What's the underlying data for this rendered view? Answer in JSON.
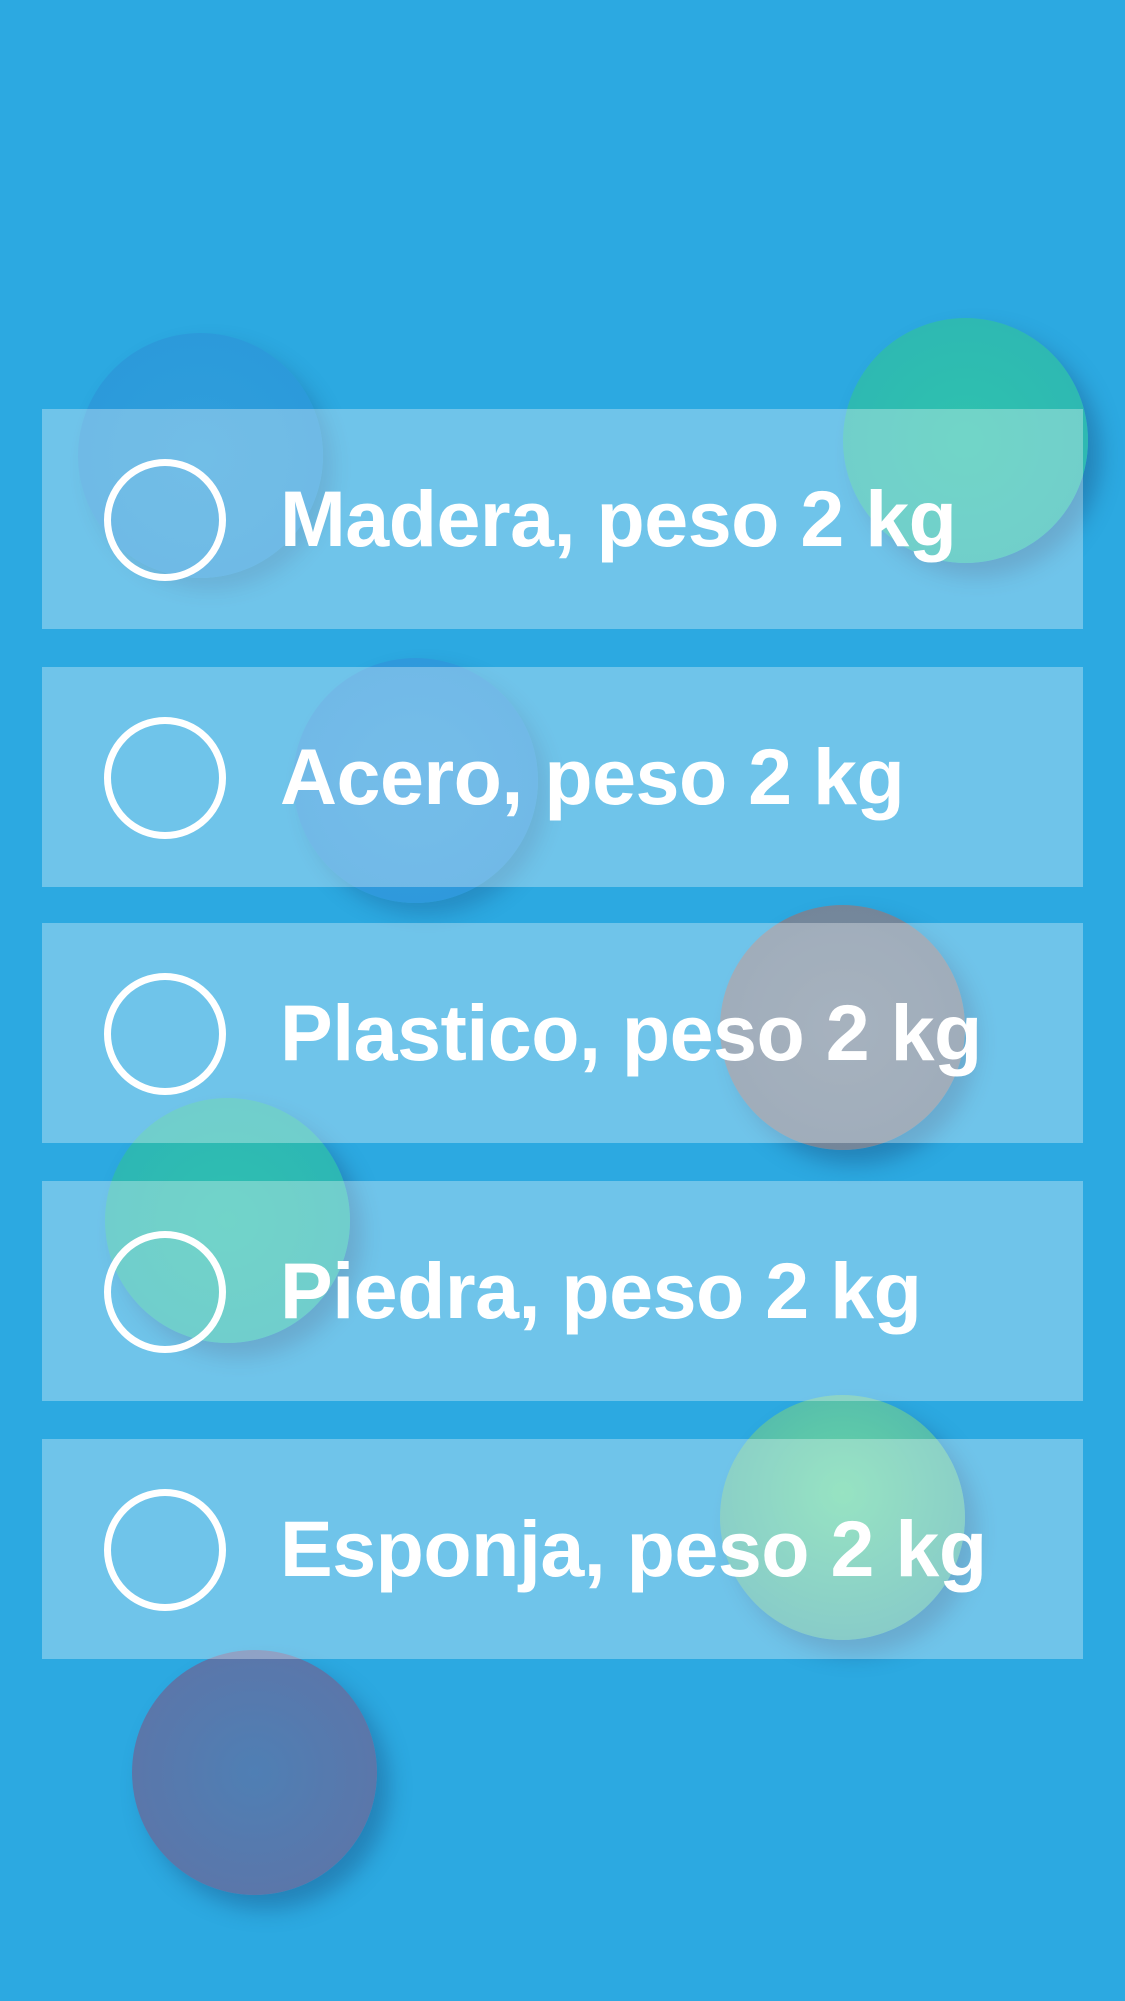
{
  "quiz": {
    "options": [
      {
        "label": "Madera, peso 2 kg"
      },
      {
        "label": "Acero, peso 2 kg"
      },
      {
        "label": "Plastico, peso 2 kg"
      },
      {
        "label": "Piedra, peso 2 kg"
      },
      {
        "label": "Esponja, peso 2 kg"
      }
    ],
    "selected": null
  },
  "decorations": {
    "balls": [
      {
        "name": "blue-ball",
        "color": "#2f9fdc"
      },
      {
        "name": "teal-ball",
        "color": "#2fc2ae"
      },
      {
        "name": "blue-ball",
        "color": "#339ee0"
      },
      {
        "name": "gray-ball",
        "color": "#7d8ea0"
      },
      {
        "name": "teal-ball",
        "color": "#2fc0b0"
      },
      {
        "name": "green-ball",
        "color": "#66d6a6"
      },
      {
        "name": "purple-ball",
        "color": "#5f73a6"
      }
    ]
  },
  "colors": {
    "background": "#2ca9e1",
    "option_fill": "rgba(255,255,255,0.32)",
    "text": "#ffffff"
  }
}
